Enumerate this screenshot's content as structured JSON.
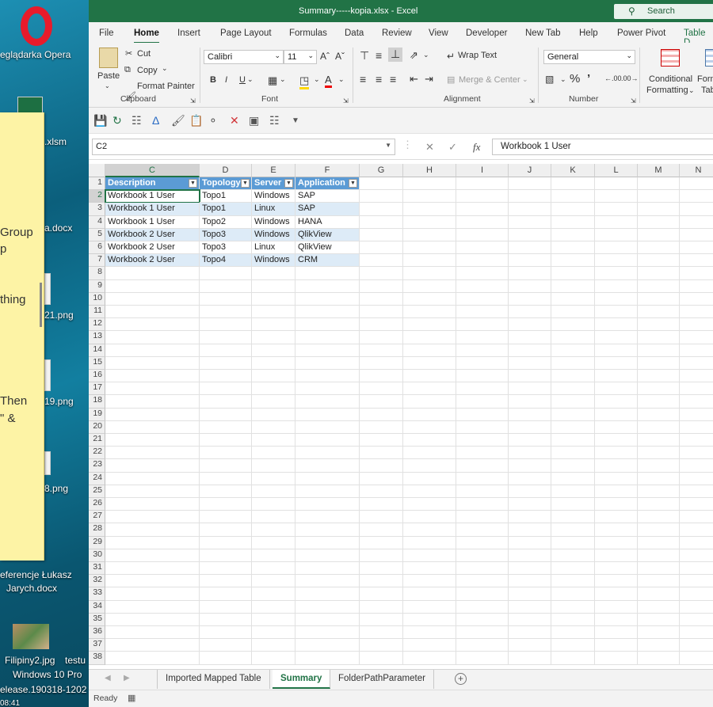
{
  "desktop": {
    "icons": [
      {
        "label": "eglądarka Opera"
      },
      {
        "label": ".xlsm"
      },
      {
        "label": "a.docx"
      },
      {
        "label": "21.png"
      },
      {
        "label": "19.png"
      },
      {
        "label": "8.png"
      },
      {
        "label": "eferencje Łukasz"
      },
      {
        "label": "Jarych.docx"
      },
      {
        "label": "Filipiny2.jpg"
      }
    ],
    "watermark": [
      "testu",
      "Windows 10 Pro",
      "elease.190318-1202"
    ],
    "clock": "08:41",
    "sticky_lines": [
      "Group",
      "p",
      "thing",
      "Then",
      "\" &"
    ]
  },
  "window": {
    "title": "Summary-----kopia.xlsx  -  Excel",
    "search": "Search"
  },
  "menu": [
    "File",
    "Home",
    "Insert",
    "Page Layout",
    "Formulas",
    "Data",
    "Review",
    "View",
    "Developer",
    "New Tab",
    "Help",
    "Power Pivot",
    "Table D"
  ],
  "ribbon": {
    "clipboard": {
      "paste": "Paste",
      "cut": "Cut",
      "copy": "Copy",
      "painter": "Format Painter",
      "group": "Clipboard"
    },
    "font": {
      "name": "Calibri",
      "size": "11",
      "group": "Font"
    },
    "alignment": {
      "wrap": "Wrap Text",
      "merge": "Merge & Center",
      "group": "Alignment"
    },
    "number": {
      "format": "General",
      "group": "Number"
    },
    "styles": {
      "cond1": "Conditional",
      "cond2": "Formatting",
      "form1": "Form",
      "form2": "Tab"
    }
  },
  "formula_bar": {
    "name_box": "C2",
    "value": "Workbook 1 User",
    "fx": "fx"
  },
  "grid": {
    "columns": [
      "C",
      "D",
      "E",
      "F",
      "G",
      "H",
      "I",
      "J",
      "K",
      "L",
      "M",
      "N"
    ],
    "rows": [
      "1",
      "2",
      "3",
      "4",
      "5",
      "6",
      "7",
      "8",
      "9",
      "10",
      "11",
      "12",
      "13",
      "14",
      "15",
      "16",
      "17",
      "18",
      "19",
      "20",
      "21",
      "22",
      "23",
      "24",
      "25",
      "26",
      "27",
      "28",
      "29",
      "30",
      "31",
      "32",
      "33",
      "34",
      "35",
      "36",
      "37",
      "38"
    ],
    "table": {
      "headers": [
        "Description",
        "Topology",
        "Server",
        "Application"
      ],
      "rows": [
        [
          "Workbook 1 User",
          "Topo1",
          "Windows",
          "SAP"
        ],
        [
          "Workbook 1 User",
          "Topo1",
          "Linux",
          "SAP"
        ],
        [
          "Workbook 1 User",
          "Topo2",
          "Windows",
          "HANA"
        ],
        [
          "Workbook 2 User",
          "Topo3",
          "Windows",
          "QlikView"
        ],
        [
          "Workbook 2 User",
          "Topo3",
          "Linux",
          "QlikView"
        ],
        [
          "Workbook 2 User",
          "Topo4",
          "Windows",
          "CRM"
        ]
      ]
    }
  },
  "sheets": [
    "Imported Mapped Table",
    "Summary",
    "FolderPathParameter"
  ],
  "status": "Ready"
}
